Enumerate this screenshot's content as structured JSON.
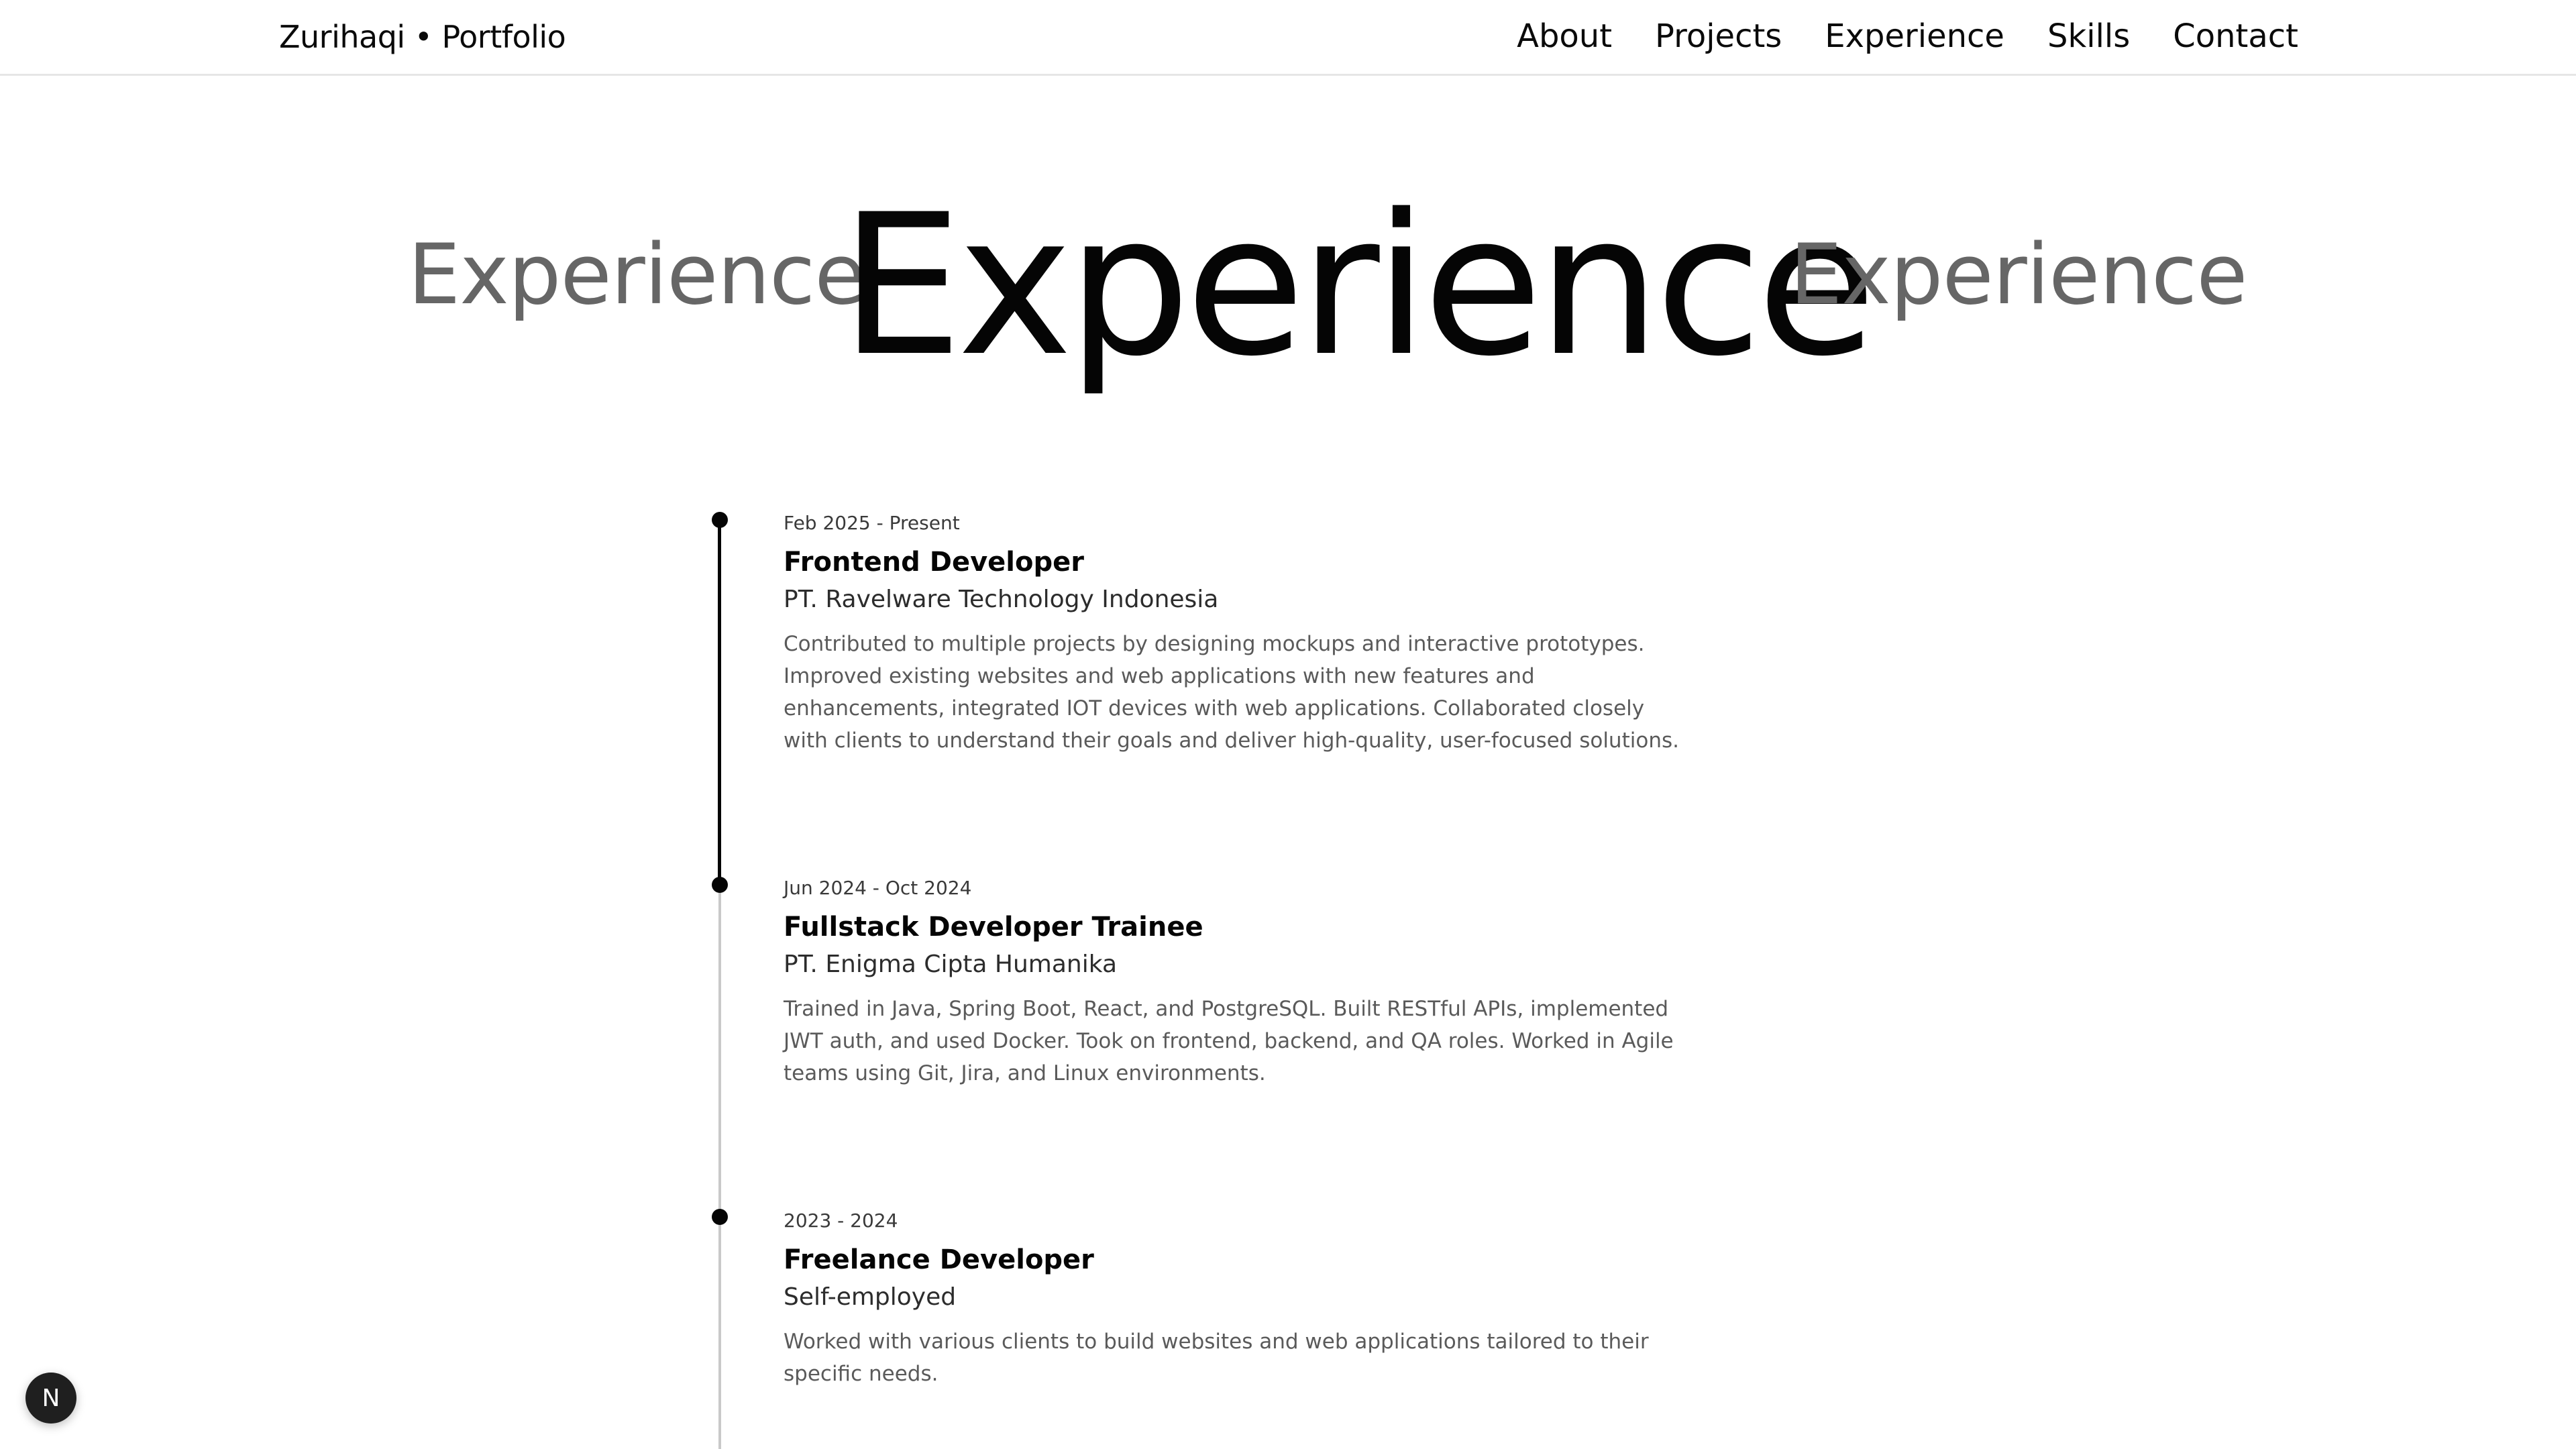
{
  "header": {
    "brand": "Zurihaqi • Portfolio",
    "nav": [
      {
        "label": "About"
      },
      {
        "label": "Projects"
      },
      {
        "label": "Experience"
      },
      {
        "label": "Skills"
      },
      {
        "label": "Contact"
      }
    ]
  },
  "hero": {
    "left": "Experience",
    "main": "Experience",
    "right": "Experience"
  },
  "experience": [
    {
      "date": "Feb 2025 - Present",
      "role": "Frontend Developer",
      "company": "PT. Ravelware Technology Indonesia",
      "description": "Contributed to multiple projects by designing mockups and interactive prototypes. Improved existing websites and web applications with new features and enhancements, integrated IOT devices with web applications. Collaborated closely with clients to understand their goals and deliver high-quality, user-focused solutions."
    },
    {
      "date": "Jun 2024 - Oct 2024",
      "role": "Fullstack Developer Trainee",
      "company": "PT. Enigma Cipta Humanika",
      "description": "Trained in Java, Spring Boot, React, and PostgreSQL. Built RESTful APIs, implemented JWT auth, and used Docker. Took on frontend, backend, and QA roles. Worked in Agile teams using Git, Jira, and Linux environments."
    },
    {
      "date": "2023 - 2024",
      "role": "Freelance Developer",
      "company": "Self-employed",
      "description": "Worked with various clients to build websites and web applications tailored to their specific needs."
    }
  ],
  "badge": {
    "label": "N",
    "icon": "next-logo-icon"
  },
  "colors": {
    "text": "#0a0a0a",
    "muted": "#666666",
    "timeline_active": "#050505",
    "timeline_inactive": "#c9c9c9"
  }
}
